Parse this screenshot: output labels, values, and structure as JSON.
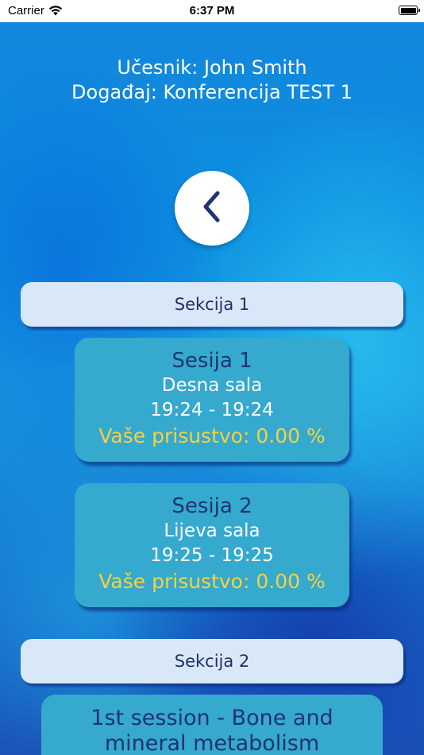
{
  "status_bar": {
    "carrier": "Carrier",
    "time": "6:37 PM"
  },
  "header": {
    "participant": "Učesnik: John Smith",
    "event": "Događaj: Konferencija TEST 1"
  },
  "icons": {
    "back": "chevron-left-icon",
    "wifi": "wifi-icon",
    "battery": "battery-icon"
  },
  "colors": {
    "attendance": "#f7d23c",
    "session_card": "#36a9cf",
    "section_bar": "#d9e8f8",
    "session_title": "#1f3470"
  },
  "sections": [
    {
      "label": "Sekcija 1",
      "sessions": [
        {
          "name": "Sesija 1",
          "room": "Desna sala",
          "time": "19:24 - 19:24",
          "attendance": "Vaše prisustvo: 0.00 %"
        },
        {
          "name": "Sesija 2",
          "room": "Lijeva sala",
          "time": "19:25 - 19:25",
          "attendance": "Vaše prisustvo: 0.00 %"
        }
      ]
    },
    {
      "label": "Sekcija 2",
      "sessions": [
        {
          "name_line1": "1st session - Bone and",
          "name_line2": "mineral metabolism"
        }
      ]
    }
  ]
}
